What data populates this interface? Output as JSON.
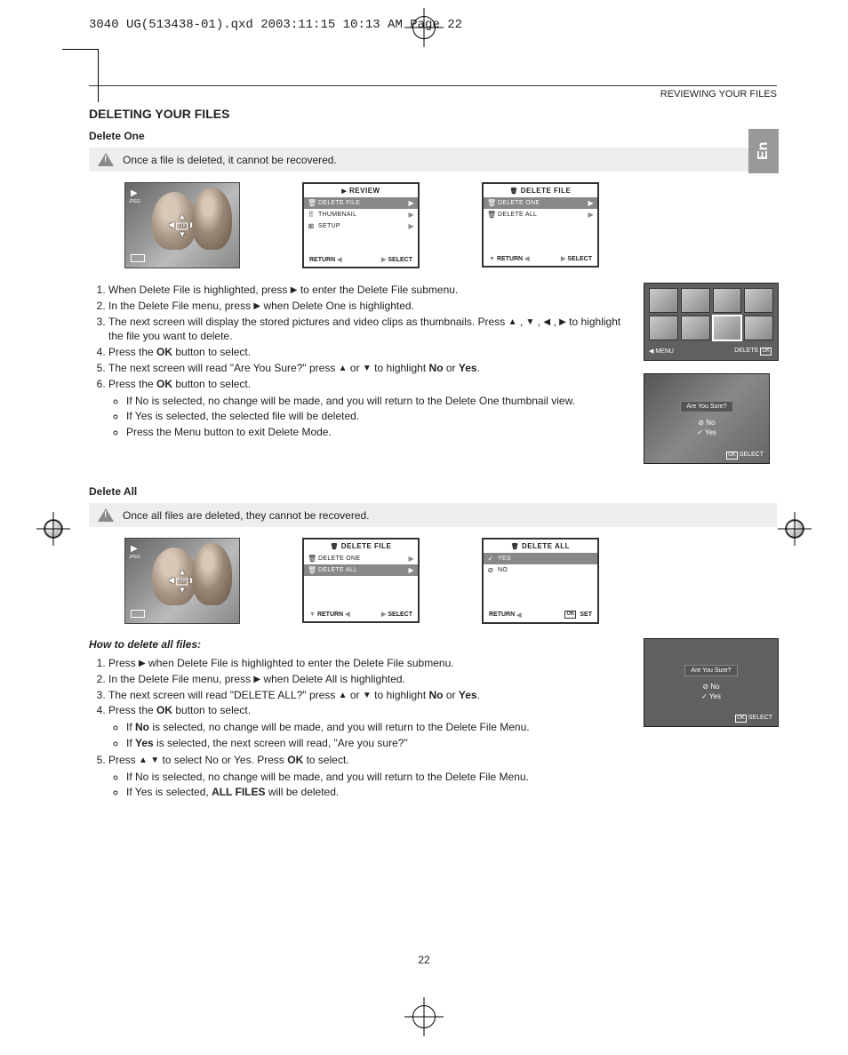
{
  "header_line": "3040 UG(513438-01).qxd  2003:11:15  10:13 AM  Page 22",
  "top_section": "REVIEWING YOUR FILES",
  "lang_tab": "En",
  "h1": "DELETING YOUR FILES",
  "h2_one": "Delete One",
  "warn_one": "Once a file is deleted, it cannot be recovered.",
  "h2_all": "Delete All",
  "warn_all": "Once all files are deleted, they cannot be recovered.",
  "how_title": "How to delete all files:",
  "page_num": "22",
  "photo": {
    "play": "▶",
    "jpeg": "JPEG",
    "nav_up": "▲",
    "nav_left": "◀",
    "nav_center": "OK",
    "nav_right": "▶",
    "nav_down": "▼"
  },
  "menu_review": {
    "title": "REVIEW",
    "title_icon": "▶",
    "items": [
      {
        "icon": "🗑",
        "label": "DELETE FILE",
        "arrow": "▶",
        "sel": true
      },
      {
        "icon": "⠿",
        "label": "THUMBNAIL",
        "arrow": "▶",
        "sel": false
      },
      {
        "icon": "⊞",
        "label": "SETUP",
        "arrow": "▶",
        "sel": false
      }
    ],
    "return": "RETURN",
    "select": "SELECT"
  },
  "menu_delete_file": {
    "title": "DELETE FILE",
    "title_icon": "🗑",
    "items": [
      {
        "icon": "🗑",
        "label": "DELETE ONE",
        "arrow": "▶",
        "sel": true
      },
      {
        "icon": "🗑",
        "label": "DELETE ALL",
        "arrow": "▶",
        "sel": false
      }
    ],
    "return": "RETURN",
    "select": "SELECT"
  },
  "menu_delete_file2": {
    "title": "DELETE FILE",
    "title_icon": "🗑",
    "items": [
      {
        "icon": "🗑",
        "label": "DELETE ONE",
        "arrow": "▶",
        "sel": false
      },
      {
        "icon": "🗑",
        "label": "DELETE ALL",
        "arrow": "▶",
        "sel": true
      }
    ],
    "return": "RETURN",
    "select": "SELECT"
  },
  "menu_delete_all": {
    "title": "DELETE ALL",
    "title_icon": "🗑",
    "items": [
      {
        "icon": "✓",
        "label": "YES",
        "arrow": "",
        "sel": true
      },
      {
        "icon": "⊘",
        "label": "NO",
        "arrow": "",
        "sel": false
      }
    ],
    "return": "RETURN",
    "set": "SET"
  },
  "thumbs_panel": {
    "menu": "MENU",
    "delete": "DELETE"
  },
  "confirm": {
    "title": "Are You Sure?",
    "no": "No",
    "yes": "Yes",
    "select": "SELECT"
  },
  "steps_one": {
    "s1a": "When Delete File is highlighted, press ",
    "s1b": " to enter the Delete File submenu.",
    "s2a": "In the Delete File menu, press ",
    "s2b": " when Delete One is highlighted.",
    "s3a": "The next screen will display the stored pictures and video clips as thumbnails. Press ",
    "s3b": " to highlight the file you want to delete.",
    "s4a": "Press the ",
    "s4b": " button to select.",
    "s5a": "The next screen will read \"Are You Sure?\" press ",
    "s5b": " or ",
    "s5c": " to highlight ",
    "s5no": "No",
    "s5or": " or ",
    "s5yes": "Yes",
    "s5end": ".",
    "s6a": "Press the ",
    "s6b": " button to select.",
    "b1": "If No is selected, no change will be made, and you will return to the Delete One thumbnail view.",
    "b2": "If Yes is selected, the selected file will be deleted.",
    "b3": "Press the Menu button to exit Delete Mode.",
    "ok": "OK"
  },
  "steps_all": {
    "s1a": "Press ",
    "s1b": " when Delete File is highlighted to enter the Delete File submenu.",
    "s2a": "In the Delete File menu, press ",
    "s2b": " when Delete All is highlighted.",
    "s3a": "The next screen will read \"DELETE ALL?\" press ",
    "s3b": " or ",
    "s3c": " to highlight ",
    "s3no": "No",
    "s3or": " or ",
    "s3yes": "Yes",
    "s3end": ".",
    "s4a": "Press the ",
    "s4b": " button to select.",
    "b1a": "If ",
    "b1no": "No",
    "b1b": " is selected, no change will be made, and you will return to the Delete File Menu.",
    "b2a": "If ",
    "b2yes": "Yes",
    "b2b": " is selected, the next screen will read, \"Are you sure?\"",
    "s5a": "Press ",
    "s5b": " to select No or Yes. Press ",
    "s5c": " to select.",
    "b3": "If No is selected, no change will be made, and you will return to the Delete File Menu.",
    "b4a": "If Yes is selected, ",
    "b4all": "ALL FILES",
    "b4b": " will be deleted.",
    "ok": "OK"
  },
  "icons": {
    "right": "▶",
    "up": "▲",
    "down": "▼",
    "left": "◀"
  }
}
